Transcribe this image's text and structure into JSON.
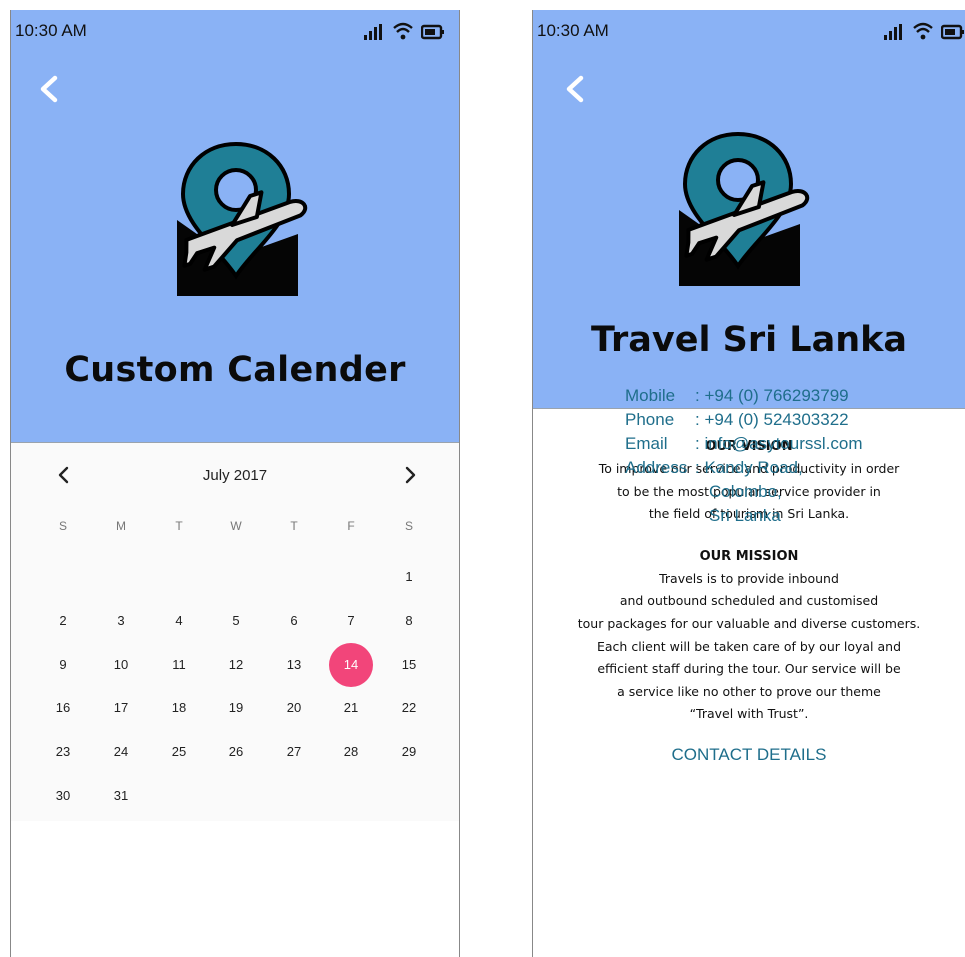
{
  "screens": {
    "calendar": {
      "status": {
        "time": "10:30 AM"
      },
      "title": "Custom Calender",
      "calendar": {
        "month": "July 2017",
        "weekdays": [
          "S",
          "M",
          "T",
          "W",
          "T",
          "F",
          "S"
        ],
        "weeks": [
          [
            "",
            "",
            "",
            "",
            "",
            "",
            "1"
          ],
          [
            "2",
            "3",
            "4",
            "5",
            "6",
            "7",
            "8"
          ],
          [
            "9",
            "10",
            "11",
            "12",
            "13",
            "14",
            "15"
          ],
          [
            "16",
            "17",
            "18",
            "19",
            "20",
            "21",
            "22"
          ],
          [
            "23",
            "24",
            "25",
            "26",
            "27",
            "28",
            "29"
          ],
          [
            "30",
            "31",
            "",
            "",
            "",
            "",
            ""
          ]
        ],
        "selected_day": "14"
      }
    },
    "about": {
      "status": {
        "time": "10:30 AM"
      },
      "title": "Travel Sri Lanka",
      "vision": {
        "heading": "OUR VISION",
        "lines": [
          "To improve our service and productivity in order",
          "to be the most popular service provider in",
          "the field of tourism in Sri Lanka."
        ]
      },
      "mission": {
        "heading": "OUR MISSION",
        "lines": [
          "Travels is to provide inbound",
          "and outbound scheduled and customised",
          "tour packages for our valuable and diverse customers.",
          "Each client will be taken care of by our loyal and",
          "efficient staff during the tour. Our service will be",
          "a service like no other to prove our theme",
          "“Travel with Trust”."
        ]
      },
      "contact": {
        "heading": "CONTACT DETAILS",
        "rows": [
          {
            "label": "Mobile",
            "value": ": +94 (0) 766293799"
          },
          {
            "label": "Phone",
            "value": ": +94 (0) 524303322"
          },
          {
            "label": "Email",
            "value": ": info@asytourssl.com"
          },
          {
            "label": "Address",
            "value": ": Kandy Road,"
          },
          {
            "label": "",
            "value": "Colombo,"
          },
          {
            "label": "",
            "value": "Sri Lanka"
          }
        ]
      }
    }
  },
  "icons": {
    "back": "chevron-left-icon",
    "signal": "signal-icon",
    "wifi": "wifi-icon",
    "battery": "battery-icon",
    "logo": "plane-map-pin-logo"
  },
  "colors": {
    "header_bg": "#8ab2f5",
    "selected_day": "#f2457a",
    "contact_text": "#1f6e8b",
    "pin_teal": "#1f7f96"
  }
}
